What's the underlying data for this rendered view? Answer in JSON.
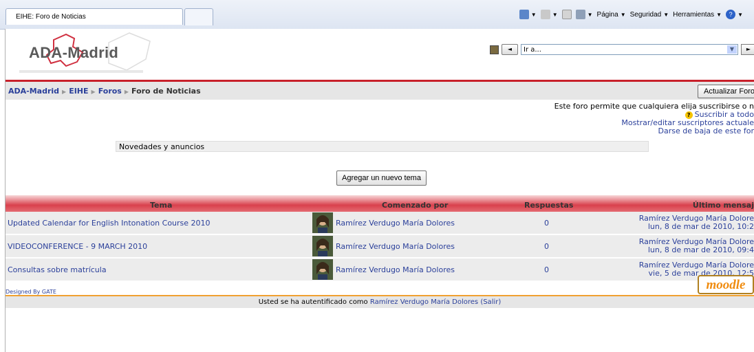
{
  "browser": {
    "tab_title": "EIHE: Foro de Noticias",
    "toolbar": [
      {
        "label": "",
        "icon": "home-icon"
      },
      {
        "label": "",
        "icon": "feeds-icon"
      },
      {
        "label": "",
        "icon": "mail-icon"
      },
      {
        "label": "",
        "icon": "print-icon"
      },
      {
        "label": "Página",
        "icon": ""
      },
      {
        "label": "Seguridad",
        "icon": ""
      },
      {
        "label": "Herramientas",
        "icon": ""
      },
      {
        "label": "",
        "icon": "help-icon"
      }
    ]
  },
  "site": {
    "logo_text": "ADA-Madrid",
    "jump_placeholder": "Ir a..."
  },
  "breadcrumb": [
    "ADA-Madrid",
    "EIHE",
    "Foros",
    "Foro de Noticias"
  ],
  "update_forum_button": "Actualizar Foro",
  "subscription": {
    "text": "Este foro permite que cualquiera elija suscribirse o n",
    "subscribe_all": "Suscribir a todo",
    "show_subscribers": "Mostrar/editar suscriptores actuale",
    "unsubscribe": "Darse de baja de este for"
  },
  "intro": "Novedades y anuncios",
  "add_topic_button": "Agregar un nuevo tema",
  "table": {
    "headers": {
      "topic": "Tema",
      "started_by": "Comenzado por",
      "replies": "Respuestas",
      "last_post": "Último mensaj"
    },
    "rows": [
      {
        "topic": "Updated Calendar for English Intonation Course 2010",
        "author": "Ramírez Verdugo María Dolores",
        "replies": "0",
        "last_author": "Ramírez Verdugo María Dolore",
        "last_date": "lun, 8 de mar de 2010, 10:2"
      },
      {
        "topic": "VIDEOCONFERENCE - 9 MARCH 2010",
        "author": "Ramírez Verdugo María Dolores",
        "replies": "0",
        "last_author": "Ramírez Verdugo María Dolore",
        "last_date": "lun, 8 de mar de 2010, 09:4"
      },
      {
        "topic": "Consultas sobre matrícula",
        "author": "Ramírez Verdugo María Dolores",
        "replies": "0",
        "last_author": "Ramírez Verdugo María Dolore",
        "last_date": "vie, 5 de mar de 2010, 12:5"
      }
    ]
  },
  "footer": {
    "designed_by": "Designed By GATE",
    "moodle_logo": "moodle",
    "login_prefix": "Usted se ha autentificado como",
    "login_user": "Ramírez Verdugo María Dolores",
    "logout": "(Salir)"
  }
}
